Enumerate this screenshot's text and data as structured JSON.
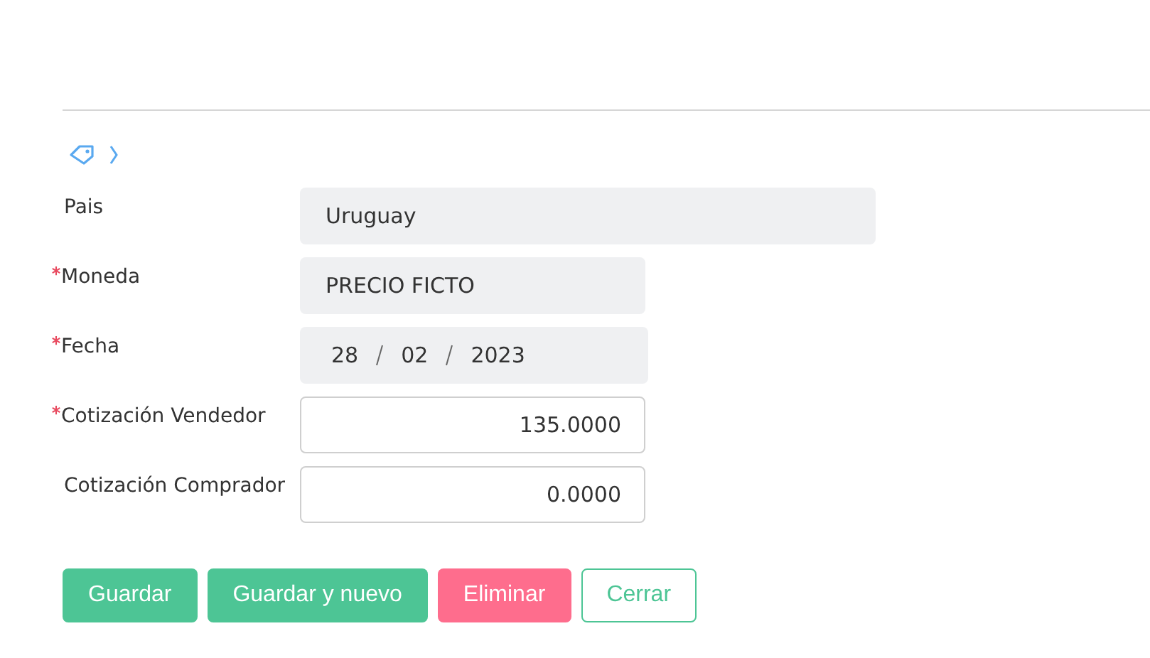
{
  "fields": [
    {
      "label": "Pais",
      "required": false,
      "kind": "readonly",
      "value": "Uruguay",
      "wide": true
    },
    {
      "label": "Moneda",
      "required": true,
      "kind": "readonly",
      "value": "PRECIO FICTO",
      "wide": false
    },
    {
      "label": "Fecha",
      "required": true,
      "kind": "date",
      "parts": [
        "28",
        "02",
        "2023"
      ]
    },
    {
      "label": "Cotización Vendedor",
      "required": true,
      "kind": "number",
      "value": "135.0000"
    },
    {
      "label": "Cotización Comprador",
      "required": false,
      "kind": "number",
      "value": "0.0000"
    }
  ],
  "buttons": [
    {
      "label": "Guardar",
      "kind": "primary"
    },
    {
      "label": "Guardar y nuevo",
      "kind": "primary"
    },
    {
      "label": "Eliminar",
      "kind": "danger"
    },
    {
      "label": "Cerrar",
      "kind": "outline"
    }
  ]
}
